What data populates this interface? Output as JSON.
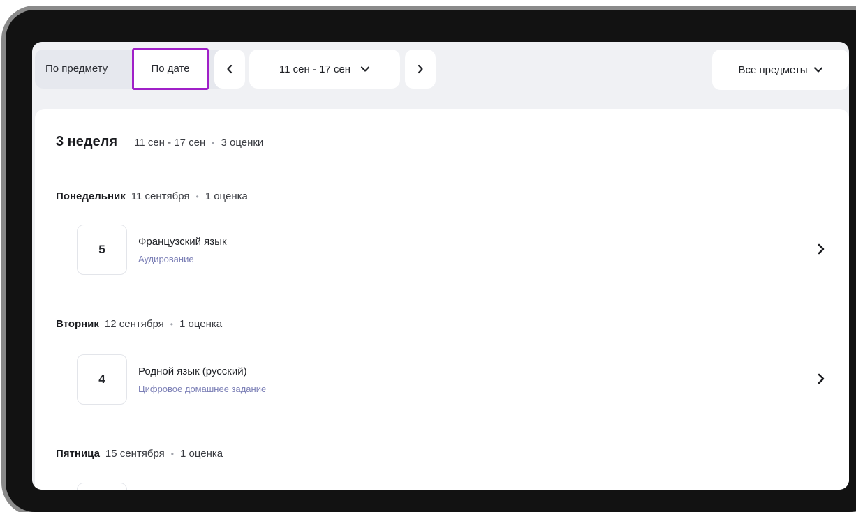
{
  "toolbar": {
    "tab_by_subject": "По предмету",
    "tab_by_date": "По дате",
    "date_range": "11 сен - 17 сен",
    "filter_label": "Все предметы",
    "highlight_color": "#a020c8"
  },
  "week": {
    "title": "3 неделя",
    "range": "11 сен - 17 сен",
    "count": "3 оценки"
  },
  "days": [
    {
      "name": "Понедельник",
      "date": "11 сентября",
      "count": "1 оценка",
      "grade": "5",
      "subject": "Французский язык",
      "work": "Аудирование"
    },
    {
      "name": "Вторник",
      "date": "12 сентября",
      "count": "1 оценка",
      "grade": "4",
      "subject": "Родной язык (русский)",
      "work": "Цифровое домашнее задание"
    },
    {
      "name": "Пятница",
      "date": "15 сентября",
      "count": "1 оценка"
    }
  ],
  "icons": {
    "prev": "chevron-left-icon",
    "next": "chevron-right-icon",
    "dropdown": "chevron-down-icon",
    "row_open": "chevron-right-icon"
  }
}
